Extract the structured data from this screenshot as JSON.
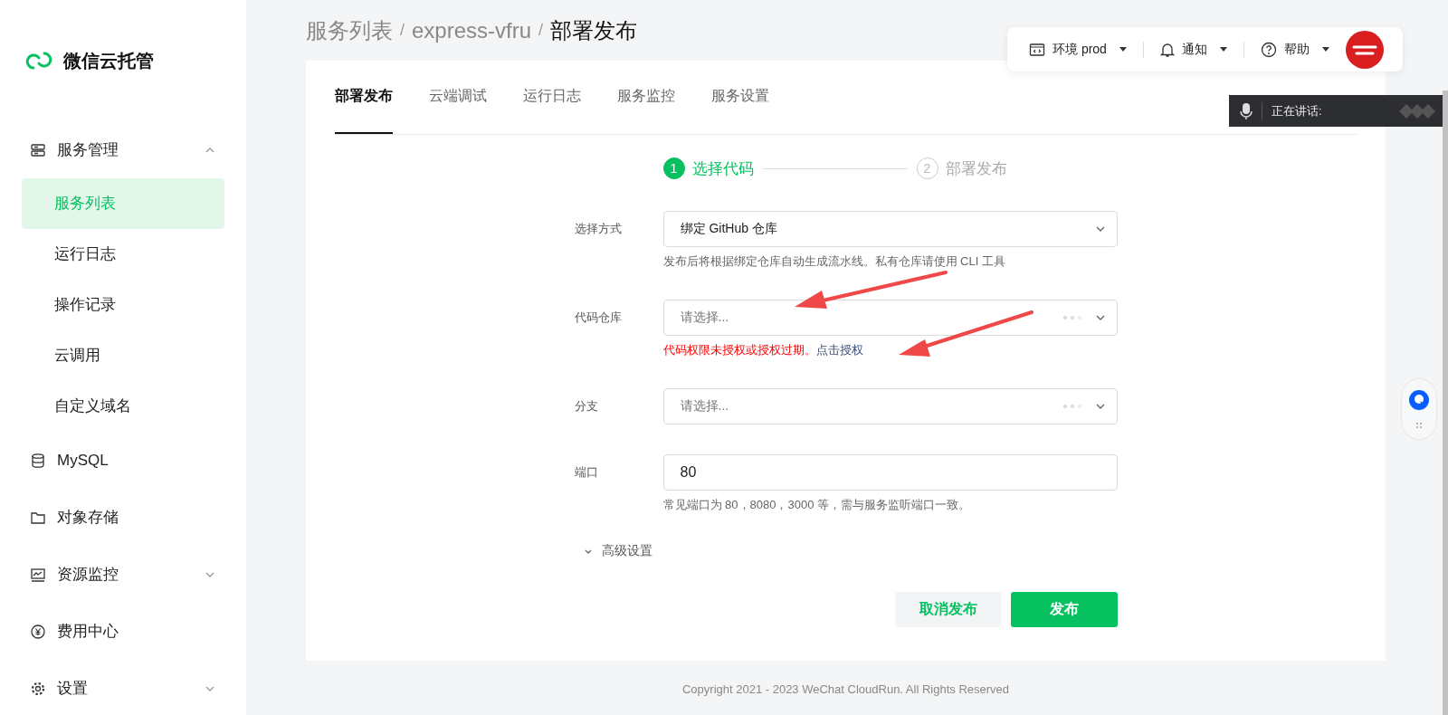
{
  "brand": {
    "name": "微信云托管"
  },
  "sidebar": {
    "items": [
      {
        "label": "服务管理",
        "expanded": true,
        "children": [
          {
            "label": "服务列表",
            "selected": true
          },
          {
            "label": "运行日志",
            "selected": false
          },
          {
            "label": "操作记录",
            "selected": false
          },
          {
            "label": "云调用",
            "selected": false
          },
          {
            "label": "自定义域名",
            "selected": false
          }
        ]
      },
      {
        "label": "MySQL"
      },
      {
        "label": "对象存储"
      },
      {
        "label": "资源监控",
        "expanded": false
      },
      {
        "label": "费用中心"
      },
      {
        "label": "设置",
        "expanded": false
      }
    ]
  },
  "breadcrumb": {
    "separator": "/",
    "items": [
      "服务列表",
      "express-vfru",
      "部署发布"
    ]
  },
  "topbar": {
    "env": "环境 prod",
    "notify": "通知",
    "help": "帮助"
  },
  "voice_bar": {
    "text": "正在讲话:"
  },
  "tabs": [
    {
      "label": "部署发布",
      "selected": true
    },
    {
      "label": "云端调试",
      "selected": false
    },
    {
      "label": "运行日志",
      "selected": false
    },
    {
      "label": "服务监控",
      "selected": false
    },
    {
      "label": "服务设置",
      "selected": false
    }
  ],
  "steps": [
    {
      "number": "1",
      "label": "选择代码",
      "selected": true
    },
    {
      "number": "2",
      "label": "部署发布",
      "selected": false
    }
  ],
  "form": [
    {
      "kind": "select",
      "label": "选择方式",
      "value": "绑定 GitHub 仓库",
      "hint": "发布后将根据绑定仓库自动生成流水线。私有仓库请使用 CLI 工具"
    },
    {
      "kind": "select",
      "label": "代码仓库",
      "placeholder": "请选择...",
      "loading": true,
      "error": "代码权限未授权或授权过期。",
      "error_link": "点击授权"
    },
    {
      "kind": "select",
      "label": "分支",
      "placeholder": "请选择...",
      "loading": true
    },
    {
      "kind": "input",
      "label": "端口",
      "value": "80",
      "hint": "常见端口为 80，8080，3000 等，需与服务监听端口一致。"
    }
  ],
  "advanced": {
    "label": "高级设置",
    "expanded": false
  },
  "buttons": {
    "cancel": "取消发布",
    "submit": "发布"
  },
  "footer": "Copyright 2021 - 2023 WeChat CloudRun. All Rights Reserved"
}
